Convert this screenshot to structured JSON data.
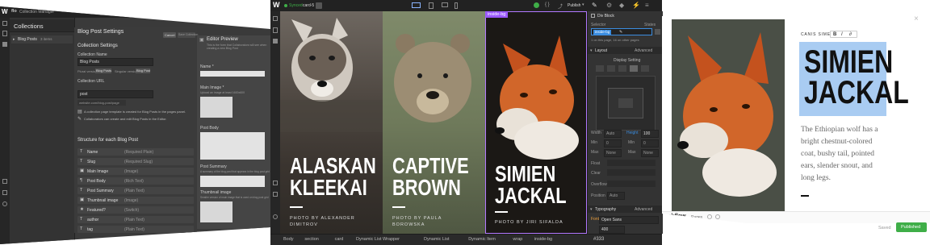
{
  "left": {
    "topbar_title": "Collection Manager",
    "header": "Collections",
    "collection_item": "Blog Posts",
    "collection_count": "3 items",
    "settings_title": "Blog Post Settings",
    "cancel_label": "Cancel",
    "save_label": "Save Collection",
    "collection_settings_title": "Collection Settings",
    "name_label": "Collection Name",
    "name_value": "Blog Posts",
    "plural_label": "Plural version:",
    "plural_value": "Blog Posts",
    "singular_label": "Singular version:",
    "singular_value": "Blog Post",
    "url_label": "Collection URL",
    "url_value": "post",
    "url_preview": "website.com/blog-post/page",
    "note1": "A collection page template is created for Blog Posts in the pages panel.",
    "note2": "Collaborators can create and edit Blog Posts in the Editor.",
    "structure_title": "Structure for each Blog Post",
    "fields": [
      {
        "icon": "T",
        "name": "Name",
        "type": "(Required Plain)"
      },
      {
        "icon": "T",
        "name": "Slug",
        "type": "(Required Slug)"
      },
      {
        "icon": "▣",
        "name": "Main Image",
        "type": "(Image)"
      },
      {
        "icon": "¶",
        "name": "Post Body",
        "type": "(Rich Text)"
      },
      {
        "icon": "T",
        "name": "Post Summary",
        "type": "(Plain Text)"
      },
      {
        "icon": "▣",
        "name": "Thumbnail image",
        "type": "(Image)"
      },
      {
        "icon": "★",
        "name": "Featured?",
        "type": "(Switch)"
      },
      {
        "icon": "T",
        "name": "author",
        "type": "(Plain Text)"
      },
      {
        "icon": "T",
        "name": "tag",
        "type": "(Plain Text)"
      }
    ],
    "preview": {
      "title": "Editor Preview",
      "note": "This is the form that Collaborators will see when creating a new Blog Post",
      "name_label": "Name *",
      "main_image_label": "Main Image *",
      "image_hint": "Upload an image at least 1600x600",
      "post_body_label": "Post Body",
      "post_summary_label": "Post Summary",
      "summary_hint": "A summary of the blog post that appears in the blog post grid",
      "thumb_label": "Thumbnail image",
      "thumb_hint": "Smaller version of main image that is used on blog post grid"
    }
  },
  "center": {
    "sync_label": "Synced",
    "card_label": "card-5",
    "publish_label": "Publish",
    "selected_tag": "inside-bg",
    "cards": [
      {
        "title": "ALASKAN\nKLEEKAI",
        "credit": "PHOTO BY ALEXANDER\nDIMITROV"
      },
      {
        "title": "CAPTIVE\nBROWN",
        "credit": "PHOTO BY PAULA\nBOROWSKA"
      },
      {
        "title": "SIMIEN\nJACKAL",
        "credit": "PHOTO BY JIRI SIFALDA"
      }
    ],
    "style_panel": {
      "element": "Div Block",
      "selector_label": "Selector",
      "states_label": "States",
      "class_pill": "inside-bg",
      "usage_note": "1 on this page, 16 on other pages",
      "layout_title": "Layout",
      "advanced": "Advanced",
      "display_title": "Display Setting",
      "width_label": "Width",
      "width_value": "Auto",
      "height_label": "Height",
      "height_value": "100",
      "min_label": "Min",
      "min_value": "0",
      "max_label": "Max",
      "max_value": "None",
      "float_label": "Float",
      "clear_label": "Clear",
      "overflow_label": "Overflow",
      "position_label": "Position",
      "position_value": "Auto",
      "typography_title": "Typography",
      "font_label": "Font",
      "font_value": "Open Sans",
      "weight_label": "Weight",
      "weight_value": "400",
      "color_label": "Color",
      "color_value": "#333"
    },
    "breadcrumbs": [
      "Body",
      "section",
      "card",
      "Dynamic List Wrapper",
      "Dynamic List",
      "Dynamic Item",
      "wrap",
      "inside-bg"
    ]
  },
  "right": {
    "credit_toolbar": "CANIS SIMEN",
    "format_buttons": [
      "B",
      "I",
      "∂"
    ],
    "headline": "SIMIEN\nJACKAL",
    "body": "The Ethiopian wolf has a\nbright chestnut-colored\ncoat, bushy tail, pointed\nears, slender snout, and\nlong legs.",
    "bottom_brand": "webflow",
    "pages_label": "Pages",
    "saved_label": "Saved",
    "publish_label": "Published"
  },
  "colors": {
    "accent_blue": "#3b8de0",
    "headline_bg": "#a9ccf2",
    "publish_green": "#3fae48",
    "dark_ui": "#2b2b2b"
  }
}
